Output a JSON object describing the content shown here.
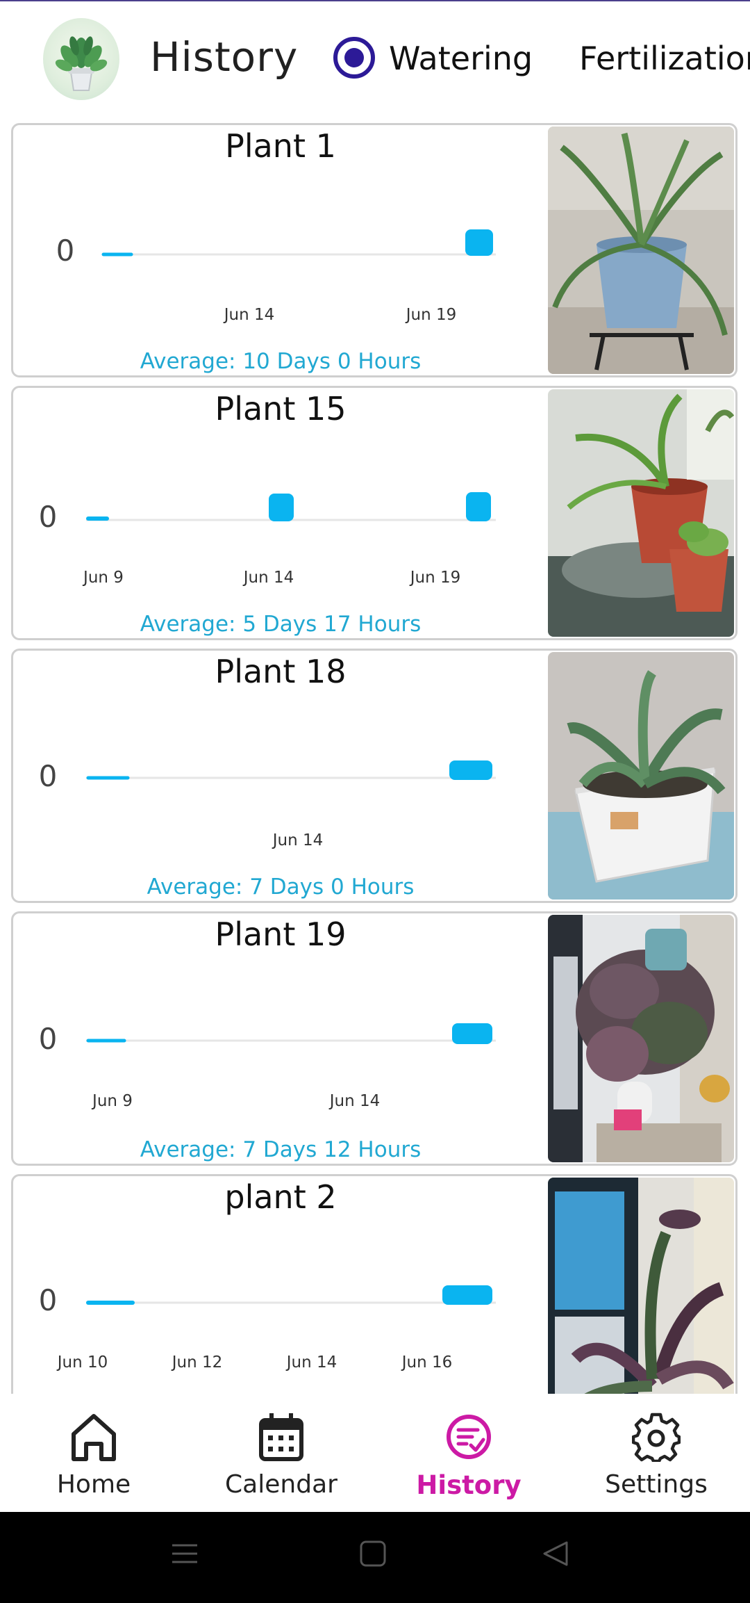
{
  "header": {
    "title": "History",
    "mode_selected": "Watering",
    "options": [
      "Watering",
      "Fertilization"
    ]
  },
  "colors": {
    "accent": "#21a8d2",
    "bar": "#0ab4f0",
    "radio": "#2c1a97",
    "nav_active": "#cc1aa5"
  },
  "plants": [
    {
      "name": "Plant 1",
      "y_label": "0",
      "x_ticks": [
        "Jun 14",
        "Jun 19"
      ],
      "average": "Average: 10 Days 0 Hours"
    },
    {
      "name": "Plant 15",
      "y_label": "0",
      "x_ticks": [
        "Jun 9",
        "Jun 14",
        "Jun 19"
      ],
      "average": "Average: 5 Days 17 Hours"
    },
    {
      "name": "Plant 18",
      "y_label": "0",
      "x_ticks": [
        "Jun 14"
      ],
      "average": "Average: 7 Days 0 Hours"
    },
    {
      "name": "Plant 19",
      "y_label": "0",
      "x_ticks": [
        "Jun 9",
        "Jun 14"
      ],
      "average": "Average: 7 Days 12 Hours"
    },
    {
      "name": "plant 2",
      "y_label": "0",
      "x_ticks": [
        "Jun 10",
        "Jun 12",
        "Jun 14",
        "Jun 16"
      ],
      "average": ""
    }
  ],
  "nav": {
    "items": [
      {
        "label": "Home",
        "icon": "home-icon"
      },
      {
        "label": "Calendar",
        "icon": "calendar-icon"
      },
      {
        "label": "History",
        "icon": "history-icon",
        "active": true
      },
      {
        "label": "Settings",
        "icon": "gear-icon"
      }
    ]
  },
  "system_bar": {
    "icons": [
      "recents-icon",
      "home-square-icon",
      "back-triangle-icon"
    ]
  }
}
